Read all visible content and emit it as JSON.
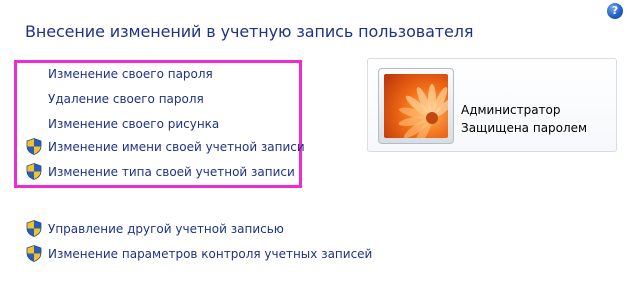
{
  "page": {
    "title": "Внесение изменений в учетную запись пользователя",
    "help_icon": "help-icon",
    "help_symbol": "?"
  },
  "tasks": [
    {
      "label": "Изменение своего пароля",
      "shield": false
    },
    {
      "label": "Удаление своего пароля",
      "shield": false
    },
    {
      "label": "Изменение своего рисунка",
      "shield": false
    },
    {
      "label": "Изменение имени своей учетной записи",
      "shield": true
    },
    {
      "label": "Изменение типа своей учетной записи",
      "shield": true
    }
  ],
  "other_tasks": [
    {
      "label": "Управление другой учетной записью",
      "shield": true
    },
    {
      "label": "Изменение параметров контроля учетных записей",
      "shield": true
    }
  ],
  "account": {
    "name": "Администратор",
    "status": "Защищена паролем",
    "picture_icon": "orange-flower-picture"
  },
  "colors": {
    "link": "#1e3287",
    "highlight": "#ee2ad2",
    "shield_blue": "#2a5db5",
    "shield_yellow": "#f2c12e"
  }
}
